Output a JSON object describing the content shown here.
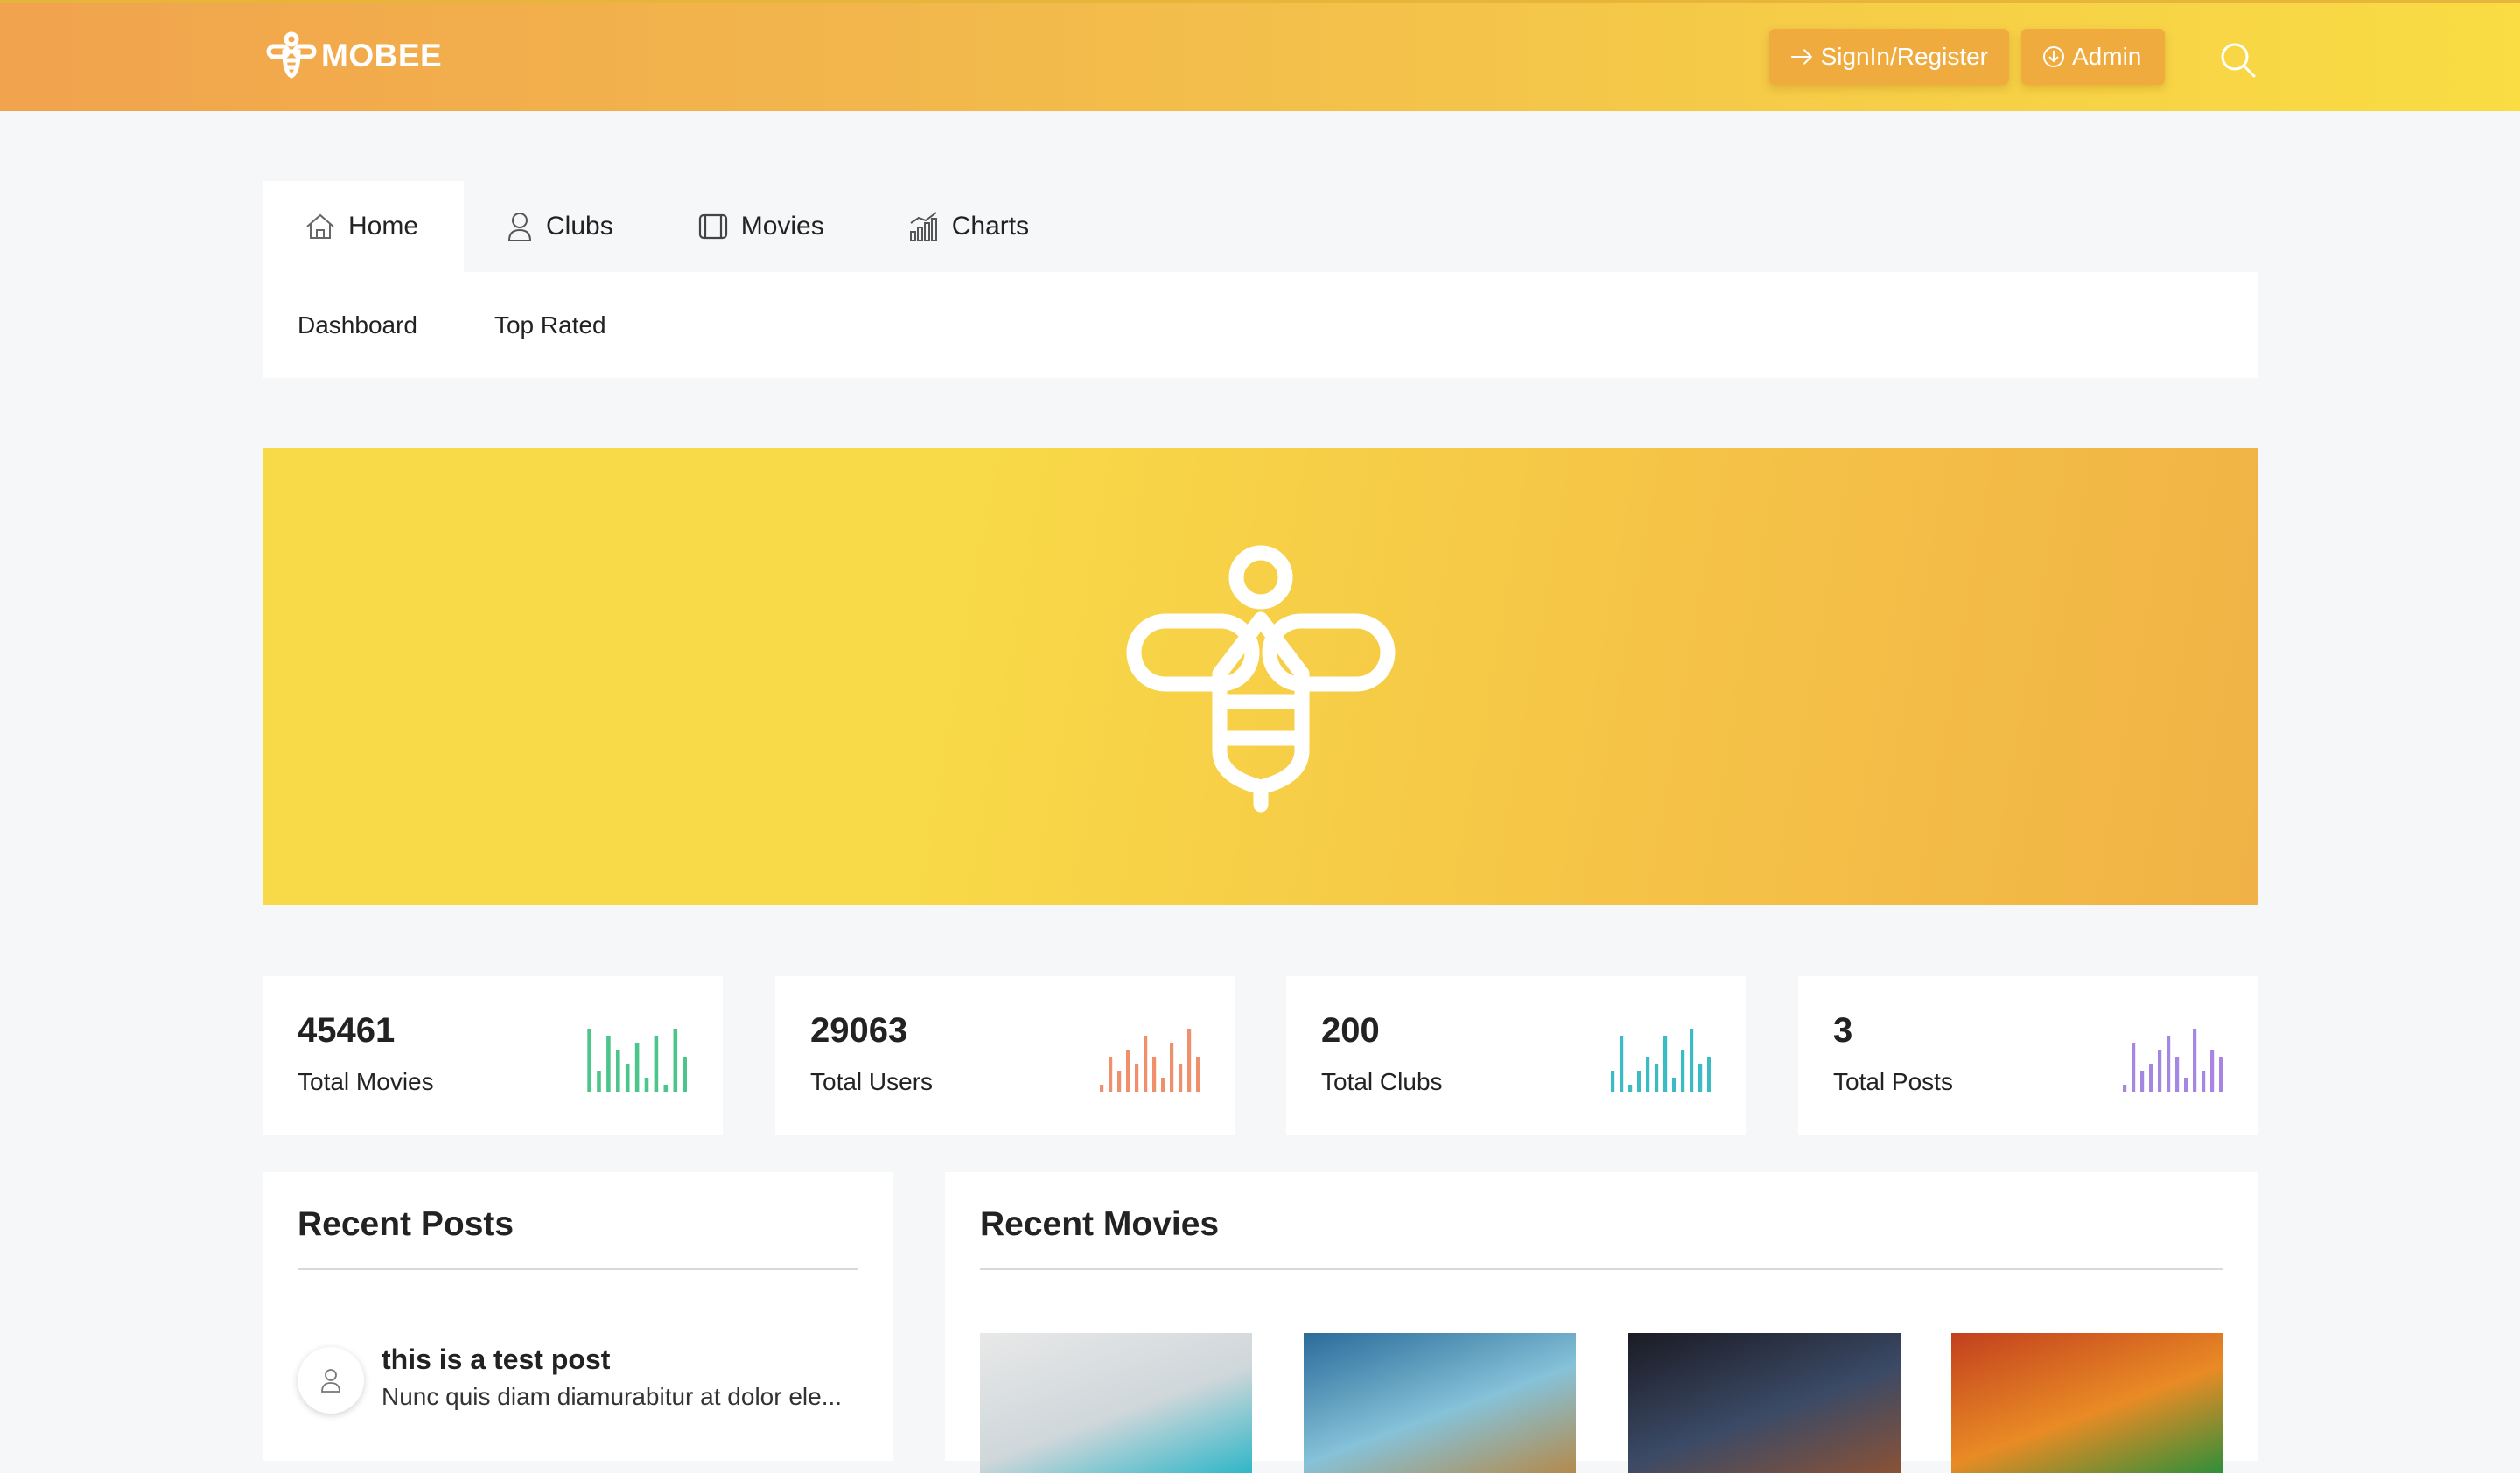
{
  "header": {
    "brand": "MOBEE",
    "signin_label": "SignIn/Register",
    "admin_label": "Admin"
  },
  "tabs": [
    {
      "label": "Home",
      "icon": "home-icon",
      "active": true
    },
    {
      "label": "Clubs",
      "icon": "user-icon",
      "active": false
    },
    {
      "label": "Movies",
      "icon": "film-icon",
      "active": false
    },
    {
      "label": "Charts",
      "icon": "chart-icon",
      "active": false
    }
  ],
  "subnav": [
    "Dashboard",
    "Top Rated"
  ],
  "stats": [
    {
      "value": "45461",
      "label": "Total Movies",
      "color": "#4cc58a",
      "bars": [
        9,
        3,
        8,
        6,
        4,
        7,
        2,
        8,
        1,
        9,
        5
      ]
    },
    {
      "value": "29063",
      "label": "Total Users",
      "color": "#ef8f6c",
      "bars": [
        1,
        5,
        3,
        6,
        4,
        8,
        5,
        2,
        7,
        4,
        9,
        5
      ]
    },
    {
      "value": "200",
      "label": "Total Clubs",
      "color": "#3bbcc4",
      "bars": [
        3,
        8,
        1,
        3,
        5,
        4,
        8,
        2,
        6,
        9,
        4,
        5
      ]
    },
    {
      "value": "3",
      "label": "Total Posts",
      "color": "#a587e3",
      "bars": [
        1,
        7,
        3,
        4,
        6,
        8,
        5,
        2,
        9,
        3,
        6,
        5
      ]
    }
  ],
  "recent_posts": {
    "title": "Recent Posts",
    "items": [
      {
        "title": "this is a test post",
        "excerpt": "Nunc quis diam diamurabitur at dolor ele..."
      }
    ]
  },
  "recent_movies": {
    "title": "Recent Movies",
    "posters": [
      {
        "name": "movie-poster-1",
        "colors": [
          "#e8e8e8",
          "#cfd7da",
          "#2fb6c8"
        ]
      },
      {
        "name": "movie-poster-2",
        "colors": [
          "#2a6b9a",
          "#86c2d8",
          "#b48a4c"
        ]
      },
      {
        "name": "movie-poster-3",
        "colors": [
          "#1b1b24",
          "#3b4a66",
          "#8a5236"
        ]
      },
      {
        "name": "movie-poster-4",
        "colors": [
          "#c2401e",
          "#e98b25",
          "#2f8f3a"
        ]
      }
    ]
  },
  "colors": {
    "header_start": "#f1a34d",
    "header_end": "#f9dd43",
    "banner": "#f8d948"
  }
}
